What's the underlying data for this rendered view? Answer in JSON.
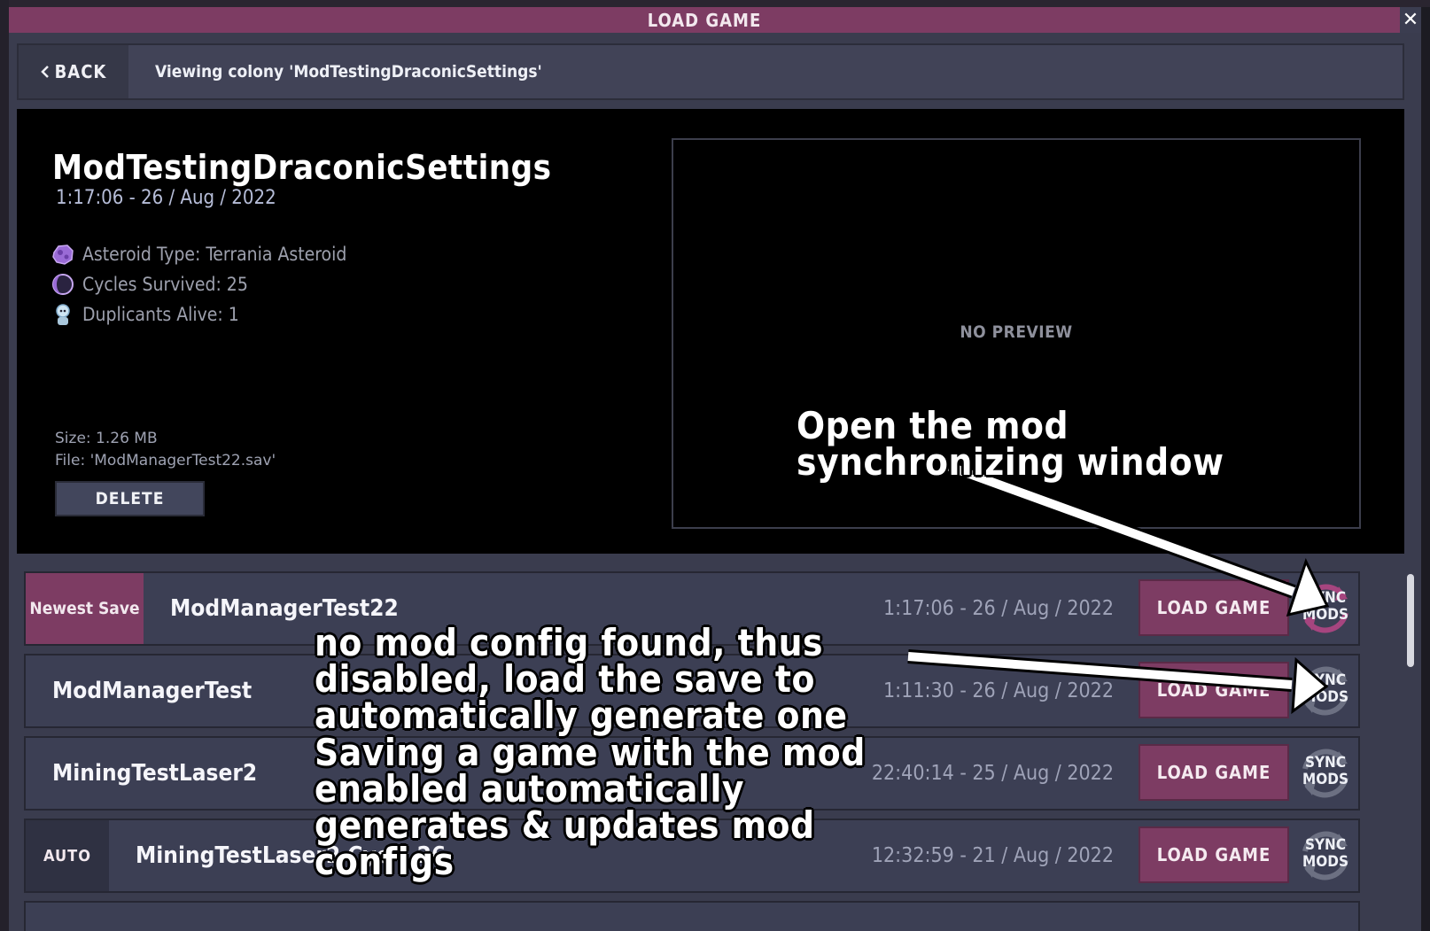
{
  "window": {
    "title": "LOAD GAME",
    "close_glyph": "✕"
  },
  "header": {
    "back_label": "BACK",
    "viewing_text": "Viewing colony 'ModTestingDraconicSettings'"
  },
  "details": {
    "colony_name": "ModTestingDraconicSettings",
    "timestamp": "1:17:06 - 26 / Aug / 2022",
    "stats": [
      {
        "icon": "asteroid-icon",
        "text": "Asteroid Type: Terrania Asteroid"
      },
      {
        "icon": "cycle-icon",
        "text": "Cycles Survived: 25"
      },
      {
        "icon": "duplicant-icon",
        "text": "Duplicants Alive: 1"
      }
    ],
    "size": "Size: 1.26 MB",
    "file": "File: 'ModManagerTest22.sav'",
    "delete_label": "DELETE",
    "preview_text": "NO PREVIEW"
  },
  "saves": [
    {
      "tag": "Newest Save",
      "name": "ModManagerTest22",
      "time": "1:17:06 - 26 / Aug / 2022",
      "load_label": "LOAD GAME",
      "sync_label": [
        "SYNC",
        "MODS"
      ],
      "sync_state": "active"
    },
    {
      "tag": "",
      "name": "ModManagerTest",
      "time": "1:11:30 - 26 / Aug / 2022",
      "load_label": "LOAD GAME",
      "sync_label": [
        "SYNC",
        "MODS"
      ],
      "sync_state": "disabled"
    },
    {
      "tag": "",
      "name": "MiningTestLaser2",
      "time": "22:40:14 - 25 / Aug / 2022",
      "load_label": "LOAD GAME",
      "sync_label": [
        "SYNC",
        "MODS"
      ],
      "sync_state": "disabled"
    },
    {
      "tag": "AUTO",
      "name": "MiningTestLaser2 Cycle 26",
      "time": "12:32:59 - 21 / Aug / 2022",
      "load_label": "LOAD GAME",
      "sync_label": [
        "SYNC",
        "MODS"
      ],
      "sync_state": "disabled"
    }
  ],
  "annotations": {
    "sync_window": "Open the mod synchronizing window",
    "no_config": "no mod config found, thus disabled, load the save to automatically generate one",
    "saving": "Saving a game with the mod enabled automatically generates & updates mod configs"
  },
  "colors": {
    "accent": "#7d3c63",
    "panel": "#3c3f54",
    "sync_active": "#7d3c63",
    "sync_disabled": "#6c7082"
  }
}
